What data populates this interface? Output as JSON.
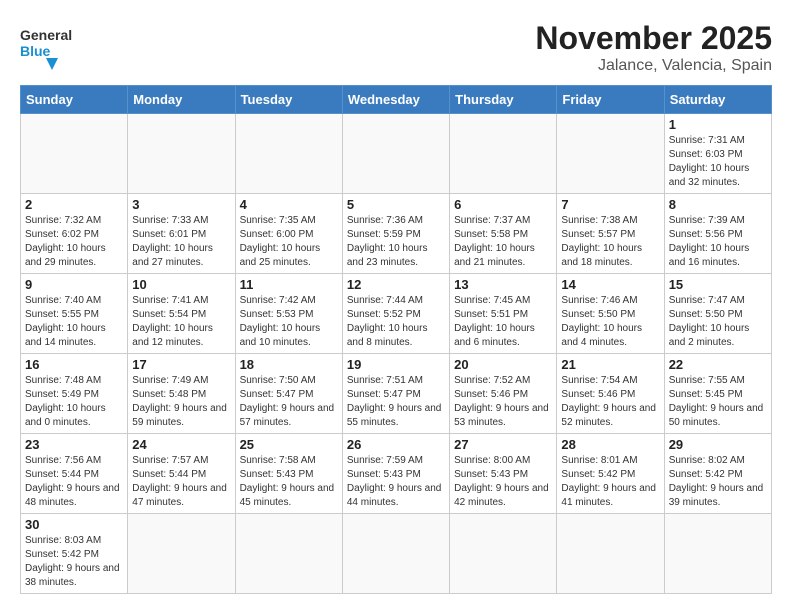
{
  "header": {
    "logo_general": "General",
    "logo_blue": "Blue",
    "title": "November 2025",
    "subtitle": "Jalance, Valencia, Spain"
  },
  "weekdays": [
    "Sunday",
    "Monday",
    "Tuesday",
    "Wednesday",
    "Thursday",
    "Friday",
    "Saturday"
  ],
  "weeks": [
    [
      {
        "day": "",
        "info": ""
      },
      {
        "day": "",
        "info": ""
      },
      {
        "day": "",
        "info": ""
      },
      {
        "day": "",
        "info": ""
      },
      {
        "day": "",
        "info": ""
      },
      {
        "day": "",
        "info": ""
      },
      {
        "day": "1",
        "info": "Sunrise: 7:31 AM\nSunset: 6:03 PM\nDaylight: 10 hours and 32 minutes."
      }
    ],
    [
      {
        "day": "2",
        "info": "Sunrise: 7:32 AM\nSunset: 6:02 PM\nDaylight: 10 hours and 29 minutes."
      },
      {
        "day": "3",
        "info": "Sunrise: 7:33 AM\nSunset: 6:01 PM\nDaylight: 10 hours and 27 minutes."
      },
      {
        "day": "4",
        "info": "Sunrise: 7:35 AM\nSunset: 6:00 PM\nDaylight: 10 hours and 25 minutes."
      },
      {
        "day": "5",
        "info": "Sunrise: 7:36 AM\nSunset: 5:59 PM\nDaylight: 10 hours and 23 minutes."
      },
      {
        "day": "6",
        "info": "Sunrise: 7:37 AM\nSunset: 5:58 PM\nDaylight: 10 hours and 21 minutes."
      },
      {
        "day": "7",
        "info": "Sunrise: 7:38 AM\nSunset: 5:57 PM\nDaylight: 10 hours and 18 minutes."
      },
      {
        "day": "8",
        "info": "Sunrise: 7:39 AM\nSunset: 5:56 PM\nDaylight: 10 hours and 16 minutes."
      }
    ],
    [
      {
        "day": "9",
        "info": "Sunrise: 7:40 AM\nSunset: 5:55 PM\nDaylight: 10 hours and 14 minutes."
      },
      {
        "day": "10",
        "info": "Sunrise: 7:41 AM\nSunset: 5:54 PM\nDaylight: 10 hours and 12 minutes."
      },
      {
        "day": "11",
        "info": "Sunrise: 7:42 AM\nSunset: 5:53 PM\nDaylight: 10 hours and 10 minutes."
      },
      {
        "day": "12",
        "info": "Sunrise: 7:44 AM\nSunset: 5:52 PM\nDaylight: 10 hours and 8 minutes."
      },
      {
        "day": "13",
        "info": "Sunrise: 7:45 AM\nSunset: 5:51 PM\nDaylight: 10 hours and 6 minutes."
      },
      {
        "day": "14",
        "info": "Sunrise: 7:46 AM\nSunset: 5:50 PM\nDaylight: 10 hours and 4 minutes."
      },
      {
        "day": "15",
        "info": "Sunrise: 7:47 AM\nSunset: 5:50 PM\nDaylight: 10 hours and 2 minutes."
      }
    ],
    [
      {
        "day": "16",
        "info": "Sunrise: 7:48 AM\nSunset: 5:49 PM\nDaylight: 10 hours and 0 minutes."
      },
      {
        "day": "17",
        "info": "Sunrise: 7:49 AM\nSunset: 5:48 PM\nDaylight: 9 hours and 59 minutes."
      },
      {
        "day": "18",
        "info": "Sunrise: 7:50 AM\nSunset: 5:47 PM\nDaylight: 9 hours and 57 minutes."
      },
      {
        "day": "19",
        "info": "Sunrise: 7:51 AM\nSunset: 5:47 PM\nDaylight: 9 hours and 55 minutes."
      },
      {
        "day": "20",
        "info": "Sunrise: 7:52 AM\nSunset: 5:46 PM\nDaylight: 9 hours and 53 minutes."
      },
      {
        "day": "21",
        "info": "Sunrise: 7:54 AM\nSunset: 5:46 PM\nDaylight: 9 hours and 52 minutes."
      },
      {
        "day": "22",
        "info": "Sunrise: 7:55 AM\nSunset: 5:45 PM\nDaylight: 9 hours and 50 minutes."
      }
    ],
    [
      {
        "day": "23",
        "info": "Sunrise: 7:56 AM\nSunset: 5:44 PM\nDaylight: 9 hours and 48 minutes."
      },
      {
        "day": "24",
        "info": "Sunrise: 7:57 AM\nSunset: 5:44 PM\nDaylight: 9 hours and 47 minutes."
      },
      {
        "day": "25",
        "info": "Sunrise: 7:58 AM\nSunset: 5:43 PM\nDaylight: 9 hours and 45 minutes."
      },
      {
        "day": "26",
        "info": "Sunrise: 7:59 AM\nSunset: 5:43 PM\nDaylight: 9 hours and 44 minutes."
      },
      {
        "day": "27",
        "info": "Sunrise: 8:00 AM\nSunset: 5:43 PM\nDaylight: 9 hours and 42 minutes."
      },
      {
        "day": "28",
        "info": "Sunrise: 8:01 AM\nSunset: 5:42 PM\nDaylight: 9 hours and 41 minutes."
      },
      {
        "day": "29",
        "info": "Sunrise: 8:02 AM\nSunset: 5:42 PM\nDaylight: 9 hours and 39 minutes."
      }
    ],
    [
      {
        "day": "30",
        "info": "Sunrise: 8:03 AM\nSunset: 5:42 PM\nDaylight: 9 hours and 38 minutes."
      },
      {
        "day": "",
        "info": ""
      },
      {
        "day": "",
        "info": ""
      },
      {
        "day": "",
        "info": ""
      },
      {
        "day": "",
        "info": ""
      },
      {
        "day": "",
        "info": ""
      },
      {
        "day": "",
        "info": ""
      }
    ]
  ]
}
